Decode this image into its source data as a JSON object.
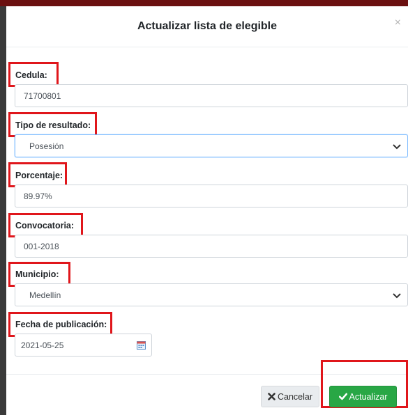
{
  "modal": {
    "title": "Actualizar lista de elegible",
    "close_symbol": "×"
  },
  "form": {
    "cedula": {
      "label": "Cedula:",
      "value": "71700801"
    },
    "tipo_resultado": {
      "label": "Tipo de resultado:",
      "selected": "Posesión"
    },
    "porcentaje": {
      "label": "Porcentaje:",
      "value": "89.97%"
    },
    "convocatoria": {
      "label": "Convocatoria:",
      "value": "001-2018"
    },
    "municipio": {
      "label": "Municipio:",
      "selected": "Medellín"
    },
    "fecha": {
      "label": "Fecha de publicación:",
      "value": "2021-05-25"
    }
  },
  "footer": {
    "cancel_label": "Cancelar",
    "update_label": "Actualizar"
  },
  "icons": {
    "close": "close-icon",
    "cancel": "x-mark-icon",
    "update": "check-icon",
    "calendar": "calendar-icon",
    "dropdown": "chevron-down-icon"
  },
  "colors": {
    "highlight": "#e0161b",
    "update_button": "#28a745",
    "cancel_button": "#e9ecef",
    "focus_border": "#80bdff"
  }
}
